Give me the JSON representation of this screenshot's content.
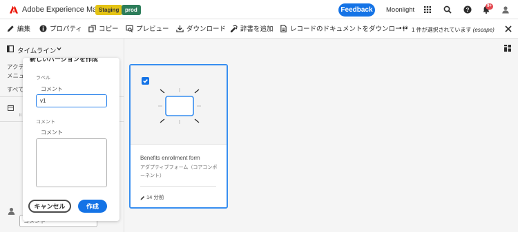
{
  "header": {
    "app_name": "Adobe Experience Manager",
    "badges": {
      "staging": "Staging",
      "prod": "prod"
    },
    "feedback_label": "Feedback",
    "org_name": "Moonlight",
    "notification_count": "9+",
    "colors": {
      "brand": "#eb1000",
      "accent": "#1473e6",
      "staging": "#e4c314",
      "prod": "#2d7d5a"
    }
  },
  "actionbar": {
    "edit": "編集",
    "properties": "プロパティ",
    "copy": "コピー",
    "preview": "プレビュー",
    "download": "ダウンロード",
    "add_dictionary": "辞書を追加",
    "download_document": "レコードのドキュメントをダウンロード",
    "more": "•••",
    "selection_count": "1 件が選択されています",
    "selection_escape": "(escape)"
  },
  "rail": {
    "view_label": "タイムライン",
    "bg_line1": "アクテ",
    "bg_line2": "メニュ",
    "bg_line3": "すべて",
    "bg_small": "lt"
  },
  "popover": {
    "title": "新しいバージョンを作成",
    "label_field_caption": "ラベル",
    "label_hint": "コメント",
    "label_value": "v1",
    "comment_field_caption": "コメント",
    "comment_hint": "コメント",
    "cancel_label": "キャンセル",
    "create_label": "作成"
  },
  "bottom": {
    "comment_placeholder": "コメント"
  },
  "card": {
    "title": "Benefits enrollment form",
    "subtitle": "アダプティブフォーム（コアコンポーネント）",
    "modified": "14 分前",
    "selected": true
  }
}
